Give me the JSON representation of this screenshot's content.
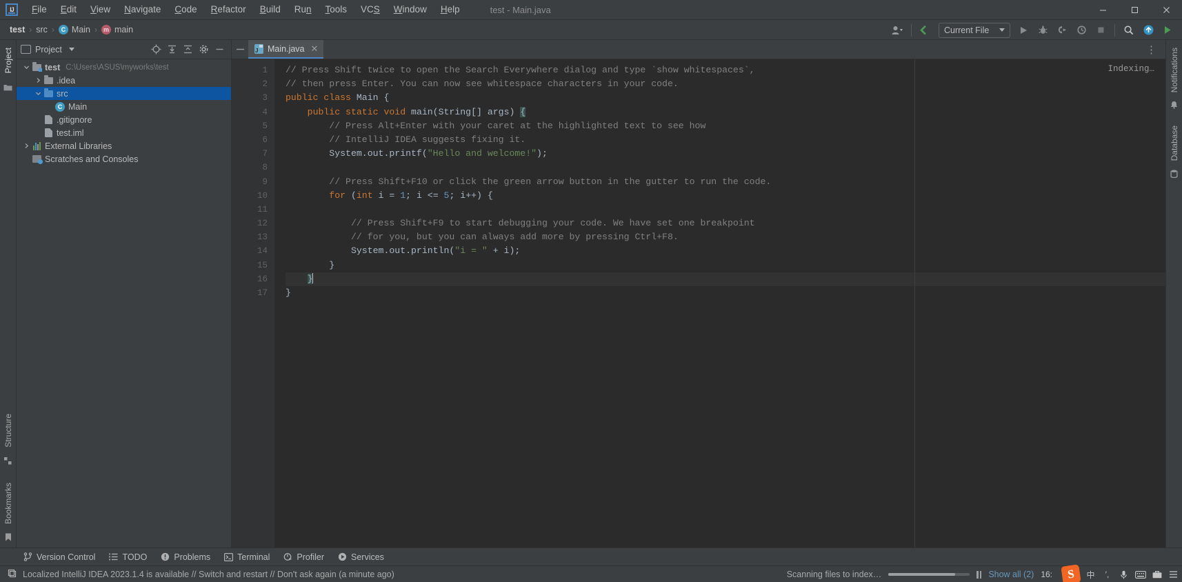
{
  "window": {
    "title": "test - Main.java",
    "controls": {
      "minimize": "—",
      "maximize": "☐",
      "close": "✕"
    }
  },
  "menu": {
    "items": [
      {
        "label": "File",
        "mnemonic": "F"
      },
      {
        "label": "Edit",
        "mnemonic": "E"
      },
      {
        "label": "View",
        "mnemonic": "V"
      },
      {
        "label": "Navigate",
        "mnemonic": "N"
      },
      {
        "label": "Code",
        "mnemonic": "C"
      },
      {
        "label": "Refactor",
        "mnemonic": "R"
      },
      {
        "label": "Build",
        "mnemonic": "B"
      },
      {
        "label": "Run",
        "mnemonic": "n"
      },
      {
        "label": "Tools",
        "mnemonic": "T"
      },
      {
        "label": "VCS",
        "mnemonic": "S"
      },
      {
        "label": "Window",
        "mnemonic": "W"
      },
      {
        "label": "Help",
        "mnemonic": "H"
      }
    ]
  },
  "breadcrumb": {
    "items": [
      {
        "label": "test",
        "icon": "none",
        "bold": true
      },
      {
        "label": "src",
        "icon": "none",
        "bold": false
      },
      {
        "label": "Main",
        "icon": "class-icon",
        "glyph": "C",
        "bold": false
      },
      {
        "label": "main",
        "icon": "method-icon",
        "glyph": "m",
        "bold": false
      }
    ],
    "separator": "›"
  },
  "toolbar": {
    "account_icon": "user-account-icon",
    "updates_icon": "update-arrow-icon",
    "run_config": "Current File",
    "run_icon": "run-play-icon",
    "debug_icon": "debug-bug-icon",
    "run_coverage_icon": "run-with-coverage-icon",
    "profiler_icon": "profiler-icon",
    "stop_icon": "stop-icon",
    "search_icon": "search-icon",
    "notifications_icon": "notification-bell-icon",
    "settings_icon": "ide-settings-icon"
  },
  "left_strip": {
    "top": [
      {
        "label": "Project",
        "icon": "project-folder-icon",
        "active": true
      }
    ],
    "bottom": [
      {
        "label": "Structure",
        "icon": "structure-icon"
      },
      {
        "label": "Bookmarks",
        "icon": "bookmark-icon"
      }
    ]
  },
  "right_strip": {
    "items": [
      {
        "label": "Notifications",
        "icon": "notifications-icon"
      },
      {
        "label": "Database",
        "icon": "database-icon"
      }
    ]
  },
  "project_panel": {
    "title": "Project",
    "view_icon": "project-view-icon",
    "dropdown_icon": "chevron-down-icon",
    "actions": [
      {
        "name": "select-opened-file",
        "icon": "crosshair-target-icon"
      },
      {
        "name": "expand-all",
        "icon": "expand-all-icon"
      },
      {
        "name": "collapse-all",
        "icon": "collapse-all-icon"
      },
      {
        "name": "options",
        "icon": "gear-icon"
      },
      {
        "name": "hide",
        "icon": "minimize-icon"
      }
    ],
    "tree": [
      {
        "label": "test",
        "path": "C:\\Users\\ASUS\\myworks\\test",
        "icon": "module-folder-icon",
        "indent": 0,
        "arrow": "expanded",
        "bold": true,
        "selected": false
      },
      {
        "label": ".idea",
        "path": "",
        "icon": "folder-icon",
        "indent": 1,
        "arrow": "collapsed",
        "bold": false,
        "selected": false
      },
      {
        "label": "src",
        "path": "",
        "icon": "source-folder-icon",
        "indent": 1,
        "arrow": "expanded",
        "bold": false,
        "selected": true
      },
      {
        "label": "Main",
        "path": "",
        "icon": "java-class-icon",
        "indent": 2,
        "arrow": "none",
        "bold": false,
        "selected": false
      },
      {
        "label": ".gitignore",
        "path": "",
        "icon": "gitignore-file-icon",
        "indent": 1,
        "arrow": "none",
        "bold": false,
        "selected": false
      },
      {
        "label": "test.iml",
        "path": "",
        "icon": "iml-file-icon",
        "indent": 1,
        "arrow": "none",
        "bold": false,
        "selected": false
      },
      {
        "label": "External Libraries",
        "path": "",
        "icon": "libraries-icon",
        "indent": 0,
        "arrow": "collapsed",
        "bold": false,
        "selected": false
      },
      {
        "label": "Scratches and Consoles",
        "path": "",
        "icon": "scratches-icon",
        "indent": 0,
        "arrow": "none",
        "bold": false,
        "selected": false
      }
    ]
  },
  "editor": {
    "tab": {
      "label": "Main.java",
      "icon": "java-file-icon",
      "close": "✕"
    },
    "more_tabs_icon": "more-options-icon",
    "status_right": "Indexing…",
    "lines": [
      {
        "n": 1,
        "fold": "start",
        "tokens": [
          {
            "t": "// Press Shift twice to open the Search Everywhere dialog and type `show whitespaces`,",
            "c": "cm"
          }
        ]
      },
      {
        "n": 2,
        "fold": "end",
        "tokens": [
          {
            "t": "// then press Enter. You can now see whitespace characters in your code.",
            "c": "cm"
          }
        ]
      },
      {
        "n": 3,
        "fold": "none",
        "tokens": [
          {
            "t": "public class ",
            "c": "kw"
          },
          {
            "t": "Main {",
            "c": "pl"
          }
        ]
      },
      {
        "n": 4,
        "fold": "start",
        "tokens": [
          {
            "t": "    public static void ",
            "c": "kw"
          },
          {
            "t": "main(String[] args) ",
            "c": "pl"
          },
          {
            "t": "{",
            "c": "br"
          }
        ]
      },
      {
        "n": 5,
        "fold": "start",
        "tokens": [
          {
            "t": "        // Press Alt+Enter with your caret at the highlighted text to see how",
            "c": "cm"
          }
        ]
      },
      {
        "n": 6,
        "fold": "end",
        "tokens": [
          {
            "t": "        // IntelliJ IDEA suggests fixing it.",
            "c": "cm"
          }
        ]
      },
      {
        "n": 7,
        "fold": "none",
        "tokens": [
          {
            "t": "        System.out.printf(",
            "c": "pl"
          },
          {
            "t": "\"Hello and welcome!\"",
            "c": "st"
          },
          {
            "t": ");",
            "c": "pl"
          }
        ]
      },
      {
        "n": 8,
        "fold": "none",
        "tokens": [
          {
            "t": "",
            "c": "pl"
          }
        ]
      },
      {
        "n": 9,
        "fold": "none",
        "tokens": [
          {
            "t": "        // Press Shift+F10 or click the green arrow button in the gutter to run the code.",
            "c": "cm"
          }
        ]
      },
      {
        "n": 10,
        "fold": "start",
        "tokens": [
          {
            "t": "        for ",
            "c": "kw"
          },
          {
            "t": "(",
            "c": "pl"
          },
          {
            "t": "int ",
            "c": "kw"
          },
          {
            "t": "i = ",
            "c": "pl"
          },
          {
            "t": "1",
            "c": "nm"
          },
          {
            "t": "; i <= ",
            "c": "pl"
          },
          {
            "t": "5",
            "c": "nm"
          },
          {
            "t": "; i++) {",
            "c": "pl"
          }
        ]
      },
      {
        "n": 11,
        "fold": "none",
        "tokens": [
          {
            "t": "",
            "c": "pl"
          }
        ]
      },
      {
        "n": 12,
        "fold": "start",
        "tokens": [
          {
            "t": "            // Press Shift+F9 to start debugging your code. We have set one breakpoint",
            "c": "cm"
          }
        ]
      },
      {
        "n": 13,
        "fold": "end",
        "tokens": [
          {
            "t": "            // for you, but you can always add more by pressing Ctrl+F8.",
            "c": "cm"
          }
        ]
      },
      {
        "n": 14,
        "fold": "none",
        "tokens": [
          {
            "t": "            System.out.println(",
            "c": "pl"
          },
          {
            "t": "\"i = \"",
            "c": "st"
          },
          {
            "t": " + i);",
            "c": "pl"
          }
        ]
      },
      {
        "n": 15,
        "fold": "end",
        "tokens": [
          {
            "t": "        }",
            "c": "pl"
          }
        ]
      },
      {
        "n": 16,
        "fold": "end",
        "tokens": [
          {
            "t": "    ",
            "c": "pl"
          },
          {
            "t": "}",
            "c": "br"
          }
        ],
        "current": true
      },
      {
        "n": 17,
        "fold": "none",
        "tokens": [
          {
            "t": "}",
            "c": "pl"
          }
        ]
      }
    ]
  },
  "tool_window_bar": {
    "tabs": [
      {
        "label": "Version Control",
        "icon": "branch-icon"
      },
      {
        "label": "TODO",
        "icon": "todo-list-icon"
      },
      {
        "label": "Problems",
        "icon": "problems-warning-icon"
      },
      {
        "label": "Terminal",
        "icon": "terminal-icon"
      },
      {
        "label": "Profiler",
        "icon": "profiler-icon"
      },
      {
        "label": "Services",
        "icon": "services-icon"
      }
    ]
  },
  "status_bar": {
    "notification_icon": "ide-notification-icon",
    "message": "Localized IntelliJ IDEA 2023.1.4 is available // Switch and restart // Don't ask again (a minute ago)",
    "progress_label": "Scanning files to index…",
    "progress_percent": 82,
    "pause_icon": "pause-icon",
    "show_all": "Show all (2)",
    "clock": "16:",
    "tray": [
      {
        "name": "sogou-ime-icon",
        "glyph": "S"
      },
      {
        "name": "ime-chinese-icon",
        "glyph": "中"
      },
      {
        "name": "ime-punctuation-icon",
        "glyph": "′,"
      },
      {
        "name": "microphone-icon",
        "glyph": "⚘"
      },
      {
        "name": "keyboard-icon",
        "glyph": "⌨"
      },
      {
        "name": "toolbox-icon",
        "glyph": "▤"
      },
      {
        "name": "settings-tray-icon",
        "glyph": "☰"
      }
    ]
  }
}
